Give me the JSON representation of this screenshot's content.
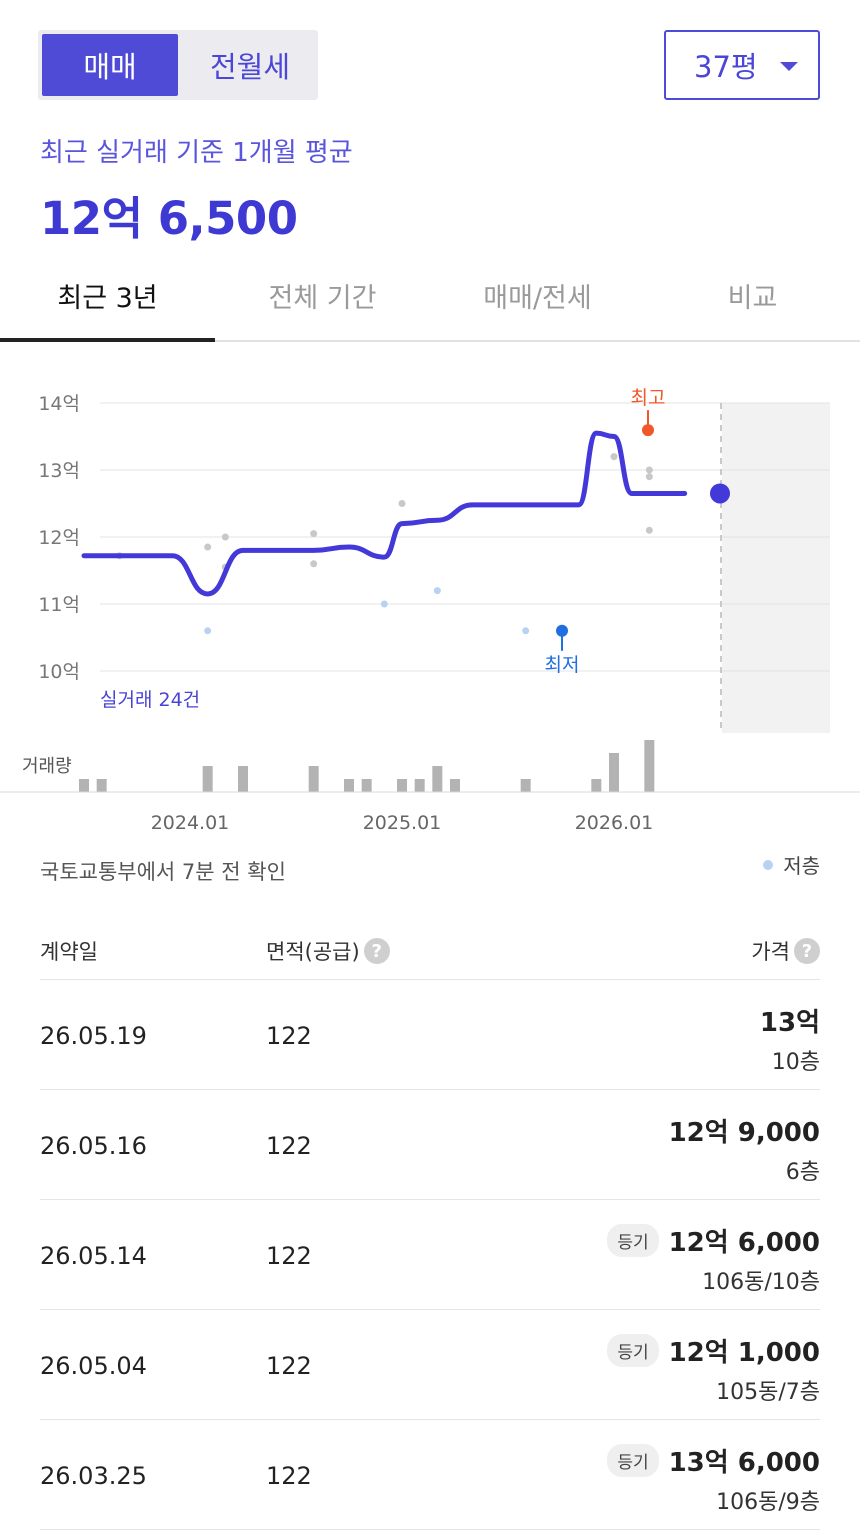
{
  "trade_toggle": {
    "active": "매매",
    "inactive": "전월세"
  },
  "size_select": {
    "value": "37평"
  },
  "summary": {
    "label": "최근 실거래 기준 1개월 평균",
    "price": "12억 6,500"
  },
  "period_tabs": [
    {
      "label": "최근 3년",
      "active": true
    },
    {
      "label": "전체 기간",
      "active": false
    },
    {
      "label": "매매/전세",
      "active": false
    },
    {
      "label": "비교",
      "active": false
    }
  ],
  "chart_data": {
    "type": "line",
    "y_unit": "억",
    "ylim": [
      10,
      14
    ],
    "y_ticks": [
      "14억",
      "13억",
      "12억",
      "11억",
      "10억"
    ],
    "x_ticks": [
      "2024.01",
      "2025.01",
      "2026.01"
    ],
    "series": [
      {
        "values_description": "monthly average line",
        "x": [
          "2023.07",
          "2023.10",
          "2023.12",
          "2024.02",
          "2024.04",
          "2024.06",
          "2024.08",
          "2024.10",
          "2024.12",
          "2025.01",
          "2025.03",
          "2025.05",
          "2025.07",
          "2025.09",
          "2025.11",
          "2025.12",
          "2026.01",
          "2026.02",
          "2026.03",
          "2026.05"
        ],
        "y": [
          11.72,
          11.72,
          11.72,
          11.15,
          11.8,
          11.8,
          11.8,
          11.85,
          11.7,
          12.2,
          12.25,
          12.48,
          12.48,
          12.48,
          12.48,
          13.55,
          13.5,
          12.65,
          12.65,
          12.65
        ]
      }
    ],
    "points": [
      {
        "x": "2023.09",
        "y": 11.72,
        "low_floor": false
      },
      {
        "x": "2024.02",
        "y": 11.85,
        "low_floor": false
      },
      {
        "x": "2024.02",
        "y": 10.6,
        "low_floor": true
      },
      {
        "x": "2024.03",
        "y": 12.0,
        "low_floor": false
      },
      {
        "x": "2024.03",
        "y": 11.55,
        "low_floor": false
      },
      {
        "x": "2024.08",
        "y": 12.05,
        "low_floor": false
      },
      {
        "x": "2024.08",
        "y": 11.6,
        "low_floor": false
      },
      {
        "x": "2024.12",
        "y": 11.0,
        "low_floor": true
      },
      {
        "x": "2025.01",
        "y": 12.5,
        "low_floor": false
      },
      {
        "x": "2025.03",
        "y": 11.2,
        "low_floor": true
      },
      {
        "x": "2025.08",
        "y": 10.6,
        "low_floor": true
      },
      {
        "x": "2026.01",
        "y": 13.2,
        "low_floor": false
      },
      {
        "x": "2026.03",
        "y": 13.0,
        "low_floor": false
      },
      {
        "x": "2026.03",
        "y": 12.9,
        "low_floor": false
      },
      {
        "x": "2026.03",
        "y": 12.1,
        "low_floor": false
      }
    ],
    "volume": [
      {
        "x": "2023.07",
        "v": 1
      },
      {
        "x": "2023.08",
        "v": 1
      },
      {
        "x": "2024.02",
        "v": 2
      },
      {
        "x": "2024.04",
        "v": 2
      },
      {
        "x": "2024.08",
        "v": 2
      },
      {
        "x": "2024.10",
        "v": 1
      },
      {
        "x": "2024.11",
        "v": 1
      },
      {
        "x": "2025.01",
        "v": 1
      },
      {
        "x": "2025.02",
        "v": 1
      },
      {
        "x": "2025.03",
        "v": 2
      },
      {
        "x": "2025.04",
        "v": 1
      },
      {
        "x": "2025.08",
        "v": 1
      },
      {
        "x": "2025.12",
        "v": 1
      },
      {
        "x": "2026.01",
        "v": 3
      },
      {
        "x": "2026.03",
        "v": 4
      }
    ],
    "annotations": {
      "high": "최고",
      "low": "최저",
      "count": "실거래 24건",
      "volume_label": "거래량"
    },
    "colors": {
      "line": "#4338d8",
      "high": "#f0582a",
      "low": "#1f6fe0",
      "low_floor_dot": "#b8d2f2",
      "dot": "#c8c8c8",
      "bar": "#b3b3b3"
    }
  },
  "footer": {
    "updated": "국토교통부에서 7분 전 확인",
    "legend": "저층"
  },
  "table": {
    "headers": {
      "date": "계약일",
      "area": "면적(공급)",
      "price": "가격"
    },
    "rows": [
      {
        "date": "26.05.19",
        "area": "122",
        "badge": "",
        "price": "13억",
        "floor": "10층"
      },
      {
        "date": "26.05.16",
        "area": "122",
        "badge": "",
        "price": "12억 9,000",
        "floor": "6층"
      },
      {
        "date": "26.05.14",
        "area": "122",
        "badge": "등기",
        "price": "12억 6,000",
        "floor": "106동/10층"
      },
      {
        "date": "26.05.04",
        "area": "122",
        "badge": "등기",
        "price": "12억 1,000",
        "floor": "105동/7층"
      },
      {
        "date": "26.03.25",
        "area": "122",
        "badge": "등기",
        "price": "13억 6,000",
        "floor": "106동/9층"
      }
    ]
  }
}
